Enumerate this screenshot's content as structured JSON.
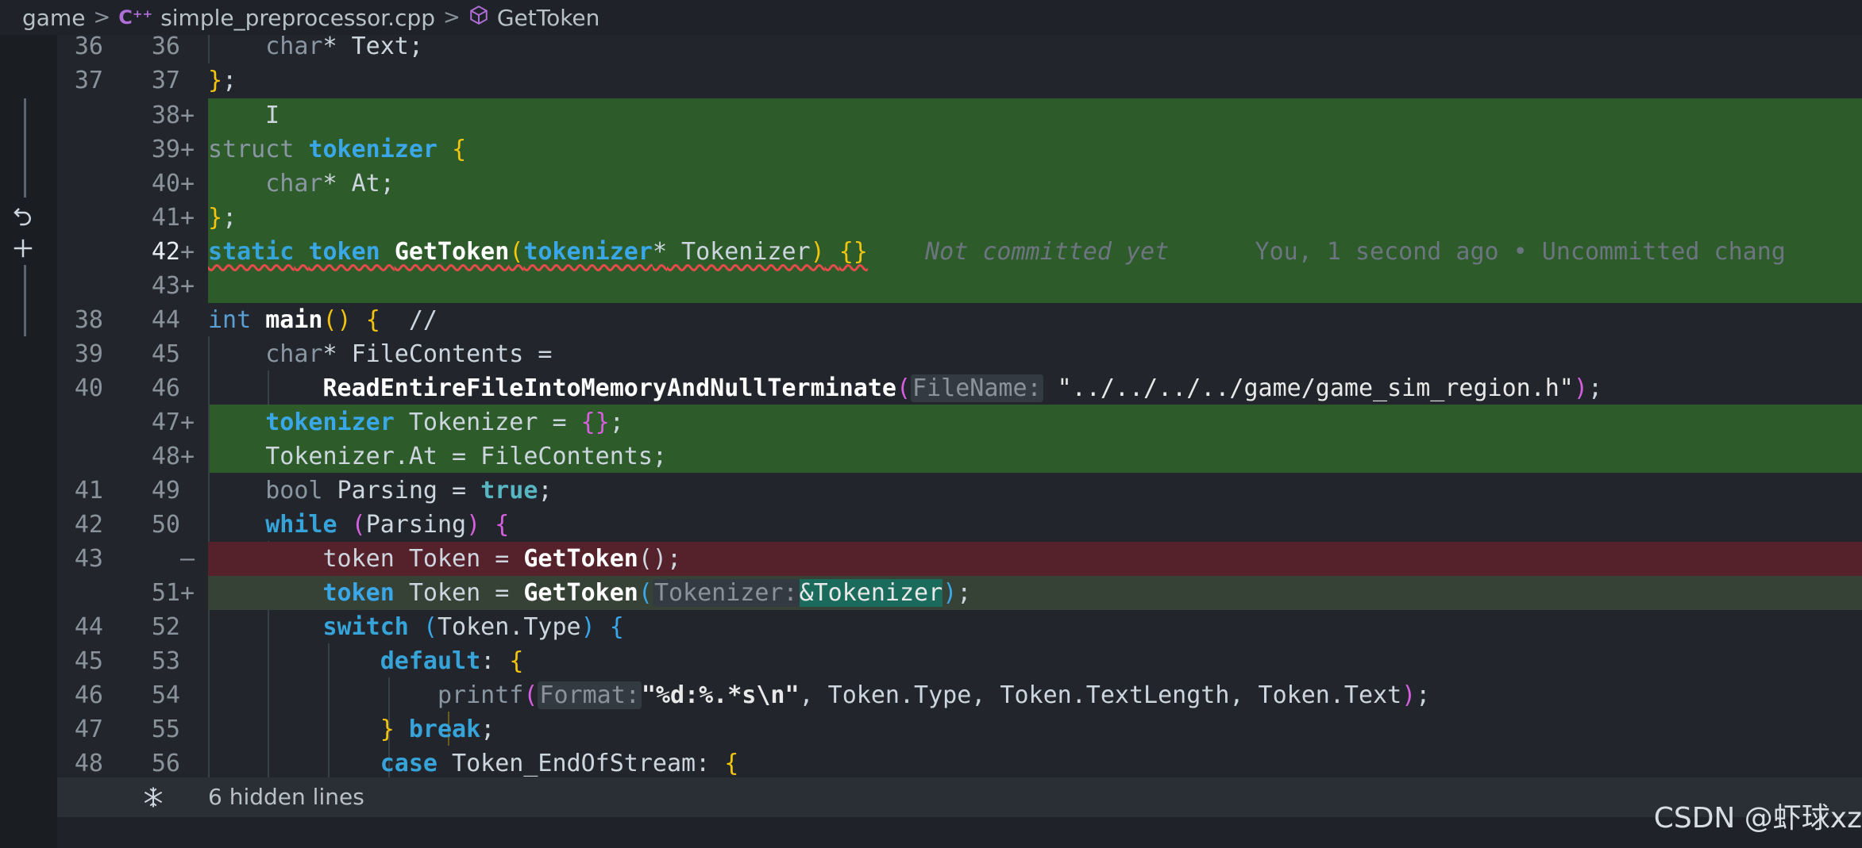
{
  "breadcrumb": {
    "folder": "game",
    "file_icon": "cpp-file-icon",
    "file": "simple_preprocessor.cpp",
    "symbol_icon": "cube-icon",
    "symbol": "GetToken"
  },
  "gutter": {
    "revert_icon": "revert-icon",
    "add_icon": "plus-icon"
  },
  "lines": [
    {
      "old": "36",
      "new": "36",
      "sign": ""
    },
    {
      "old": "37",
      "new": "37",
      "sign": ""
    },
    {
      "old": "",
      "new": "38",
      "sign": "+"
    },
    {
      "old": "",
      "new": "39",
      "sign": "+"
    },
    {
      "old": "",
      "new": "40",
      "sign": "+"
    },
    {
      "old": "",
      "new": "41",
      "sign": "+"
    },
    {
      "old": "",
      "new": "42",
      "sign": "+"
    },
    {
      "old": "",
      "new": "43",
      "sign": "+"
    },
    {
      "old": "38",
      "new": "44",
      "sign": ""
    },
    {
      "old": "39",
      "new": "45",
      "sign": ""
    },
    {
      "old": "40",
      "new": "46",
      "sign": ""
    },
    {
      "old": "",
      "new": "47",
      "sign": "+"
    },
    {
      "old": "",
      "new": "48",
      "sign": "+"
    },
    {
      "old": "41",
      "new": "49",
      "sign": ""
    },
    {
      "old": "42",
      "new": "50",
      "sign": ""
    },
    {
      "old": "43",
      "new": "",
      "sign": "—"
    },
    {
      "old": "",
      "new": "51",
      "sign": "+"
    },
    {
      "old": "44",
      "new": "52",
      "sign": ""
    },
    {
      "old": "45",
      "new": "53",
      "sign": ""
    },
    {
      "old": "46",
      "new": "54",
      "sign": ""
    },
    {
      "old": "47",
      "new": "55",
      "sign": ""
    },
    {
      "old": "48",
      "new": "56",
      "sign": ""
    }
  ],
  "code": {
    "l36": {
      "type": "char",
      "rest": "* Text;"
    },
    "l37": {
      "close": "}",
      "semi": ";"
    },
    "l39": {
      "kw": "struct",
      "name": "tokenizer",
      "brace": "{"
    },
    "l40": {
      "type": "char",
      "rest": "* At;"
    },
    "l41": {
      "close": "}",
      "semi": ";"
    },
    "l42": {
      "static": "static",
      "rettype": "token",
      "fn": "GetToken",
      "lp": "(",
      "ptype": "tokenizer",
      "star": "*",
      "param": " Tokenizer",
      "rp": ")",
      "body": "{}"
    },
    "blame": {
      "status": "Not committed yet",
      "author": "You, 1 second ago • Uncommitted chang"
    },
    "l44": {
      "type": "int",
      "fn": "main",
      "parens": "()",
      "brace": "{",
      "comment": "//"
    },
    "l45": {
      "type": "char",
      "rest": "* FileContents ="
    },
    "l46": {
      "fn": "ReadEntireFileIntoMemoryAndNullTerminate",
      "lp": "(",
      "hint": "FileName:",
      "str": "\"../../../../game/game_sim_region.h\"",
      "rp": ")",
      "semi": ";"
    },
    "l47": {
      "type": "tokenizer",
      "rest": " Tokenizer = ",
      "brace": "{}",
      "semi": ";"
    },
    "l48": {
      "text": "Tokenizer.At = FileContents;"
    },
    "l49": {
      "type": "bool",
      "rest": " Parsing = ",
      "val": "true",
      "semi": ";"
    },
    "l50": {
      "kw": "while",
      "lp": "(",
      "cond": "Parsing",
      "rp": ")",
      "brace": "{"
    },
    "ldel": {
      "type": "token",
      "rest": " Token = ",
      "fn": "GetToken",
      "parens": "()",
      "semi": ";"
    },
    "l51": {
      "type": "token",
      "rest": " Token = ",
      "fn": "GetToken",
      "lp": "(",
      "hint": "Tokenizer:",
      "amp": "&",
      "arg": "Tokenizer",
      "rp": ")",
      "semi": ";"
    },
    "l52": {
      "kw": "switch",
      "lp": "(",
      "cond": "Token.Type",
      "rp": ")",
      "brace": "{"
    },
    "l53": {
      "kw": "default",
      "colon": ": ",
      "brace": "{"
    },
    "l54": {
      "fn": "printf",
      "lp": "(",
      "hint": "Format:",
      "str": "\"%d:%.*s\\n\"",
      "rest": ", Token.Type, Token.TextLength, Token.Text",
      "rp": ")",
      "semi": ";"
    },
    "l55": {
      "close": "}",
      "kw": "break",
      "semi": ";"
    },
    "l56": {
      "kw": "case",
      "rest": " Token_EndOfStream: ",
      "brace": "{"
    }
  },
  "hidden": {
    "icon": "fold-icon",
    "label": "6 hidden lines"
  },
  "watermark": "CSDN @虾球xz"
}
